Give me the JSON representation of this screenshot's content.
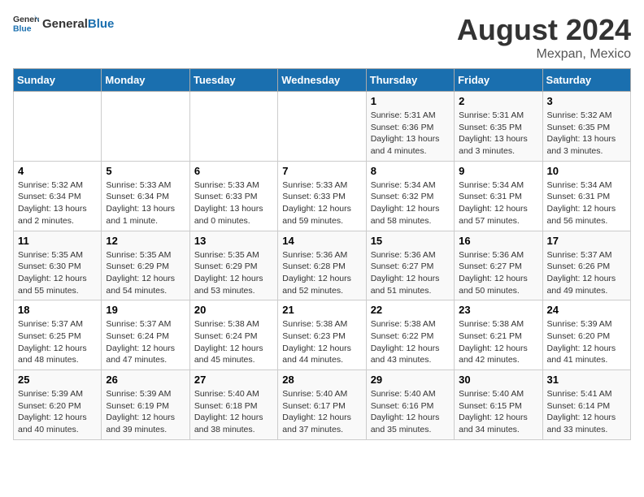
{
  "header": {
    "logo_general": "General",
    "logo_blue": "Blue",
    "month_year": "August 2024",
    "location": "Mexpan, Mexico"
  },
  "weekdays": [
    "Sunday",
    "Monday",
    "Tuesday",
    "Wednesday",
    "Thursday",
    "Friday",
    "Saturday"
  ],
  "weeks": [
    [
      {
        "day": "",
        "info": ""
      },
      {
        "day": "",
        "info": ""
      },
      {
        "day": "",
        "info": ""
      },
      {
        "day": "",
        "info": ""
      },
      {
        "day": "1",
        "info": "Sunrise: 5:31 AM\nSunset: 6:36 PM\nDaylight: 13 hours\nand 4 minutes."
      },
      {
        "day": "2",
        "info": "Sunrise: 5:31 AM\nSunset: 6:35 PM\nDaylight: 13 hours\nand 3 minutes."
      },
      {
        "day": "3",
        "info": "Sunrise: 5:32 AM\nSunset: 6:35 PM\nDaylight: 13 hours\nand 3 minutes."
      }
    ],
    [
      {
        "day": "4",
        "info": "Sunrise: 5:32 AM\nSunset: 6:34 PM\nDaylight: 13 hours\nand 2 minutes."
      },
      {
        "day": "5",
        "info": "Sunrise: 5:33 AM\nSunset: 6:34 PM\nDaylight: 13 hours\nand 1 minute."
      },
      {
        "day": "6",
        "info": "Sunrise: 5:33 AM\nSunset: 6:33 PM\nDaylight: 13 hours\nand 0 minutes."
      },
      {
        "day": "7",
        "info": "Sunrise: 5:33 AM\nSunset: 6:33 PM\nDaylight: 12 hours\nand 59 minutes."
      },
      {
        "day": "8",
        "info": "Sunrise: 5:34 AM\nSunset: 6:32 PM\nDaylight: 12 hours\nand 58 minutes."
      },
      {
        "day": "9",
        "info": "Sunrise: 5:34 AM\nSunset: 6:31 PM\nDaylight: 12 hours\nand 57 minutes."
      },
      {
        "day": "10",
        "info": "Sunrise: 5:34 AM\nSunset: 6:31 PM\nDaylight: 12 hours\nand 56 minutes."
      }
    ],
    [
      {
        "day": "11",
        "info": "Sunrise: 5:35 AM\nSunset: 6:30 PM\nDaylight: 12 hours\nand 55 minutes."
      },
      {
        "day": "12",
        "info": "Sunrise: 5:35 AM\nSunset: 6:29 PM\nDaylight: 12 hours\nand 54 minutes."
      },
      {
        "day": "13",
        "info": "Sunrise: 5:35 AM\nSunset: 6:29 PM\nDaylight: 12 hours\nand 53 minutes."
      },
      {
        "day": "14",
        "info": "Sunrise: 5:36 AM\nSunset: 6:28 PM\nDaylight: 12 hours\nand 52 minutes."
      },
      {
        "day": "15",
        "info": "Sunrise: 5:36 AM\nSunset: 6:27 PM\nDaylight: 12 hours\nand 51 minutes."
      },
      {
        "day": "16",
        "info": "Sunrise: 5:36 AM\nSunset: 6:27 PM\nDaylight: 12 hours\nand 50 minutes."
      },
      {
        "day": "17",
        "info": "Sunrise: 5:37 AM\nSunset: 6:26 PM\nDaylight: 12 hours\nand 49 minutes."
      }
    ],
    [
      {
        "day": "18",
        "info": "Sunrise: 5:37 AM\nSunset: 6:25 PM\nDaylight: 12 hours\nand 48 minutes."
      },
      {
        "day": "19",
        "info": "Sunrise: 5:37 AM\nSunset: 6:24 PM\nDaylight: 12 hours\nand 47 minutes."
      },
      {
        "day": "20",
        "info": "Sunrise: 5:38 AM\nSunset: 6:24 PM\nDaylight: 12 hours\nand 45 minutes."
      },
      {
        "day": "21",
        "info": "Sunrise: 5:38 AM\nSunset: 6:23 PM\nDaylight: 12 hours\nand 44 minutes."
      },
      {
        "day": "22",
        "info": "Sunrise: 5:38 AM\nSunset: 6:22 PM\nDaylight: 12 hours\nand 43 minutes."
      },
      {
        "day": "23",
        "info": "Sunrise: 5:38 AM\nSunset: 6:21 PM\nDaylight: 12 hours\nand 42 minutes."
      },
      {
        "day": "24",
        "info": "Sunrise: 5:39 AM\nSunset: 6:20 PM\nDaylight: 12 hours\nand 41 minutes."
      }
    ],
    [
      {
        "day": "25",
        "info": "Sunrise: 5:39 AM\nSunset: 6:20 PM\nDaylight: 12 hours\nand 40 minutes."
      },
      {
        "day": "26",
        "info": "Sunrise: 5:39 AM\nSunset: 6:19 PM\nDaylight: 12 hours\nand 39 minutes."
      },
      {
        "day": "27",
        "info": "Sunrise: 5:40 AM\nSunset: 6:18 PM\nDaylight: 12 hours\nand 38 minutes."
      },
      {
        "day": "28",
        "info": "Sunrise: 5:40 AM\nSunset: 6:17 PM\nDaylight: 12 hours\nand 37 minutes."
      },
      {
        "day": "29",
        "info": "Sunrise: 5:40 AM\nSunset: 6:16 PM\nDaylight: 12 hours\nand 35 minutes."
      },
      {
        "day": "30",
        "info": "Sunrise: 5:40 AM\nSunset: 6:15 PM\nDaylight: 12 hours\nand 34 minutes."
      },
      {
        "day": "31",
        "info": "Sunrise: 5:41 AM\nSunset: 6:14 PM\nDaylight: 12 hours\nand 33 minutes."
      }
    ]
  ]
}
